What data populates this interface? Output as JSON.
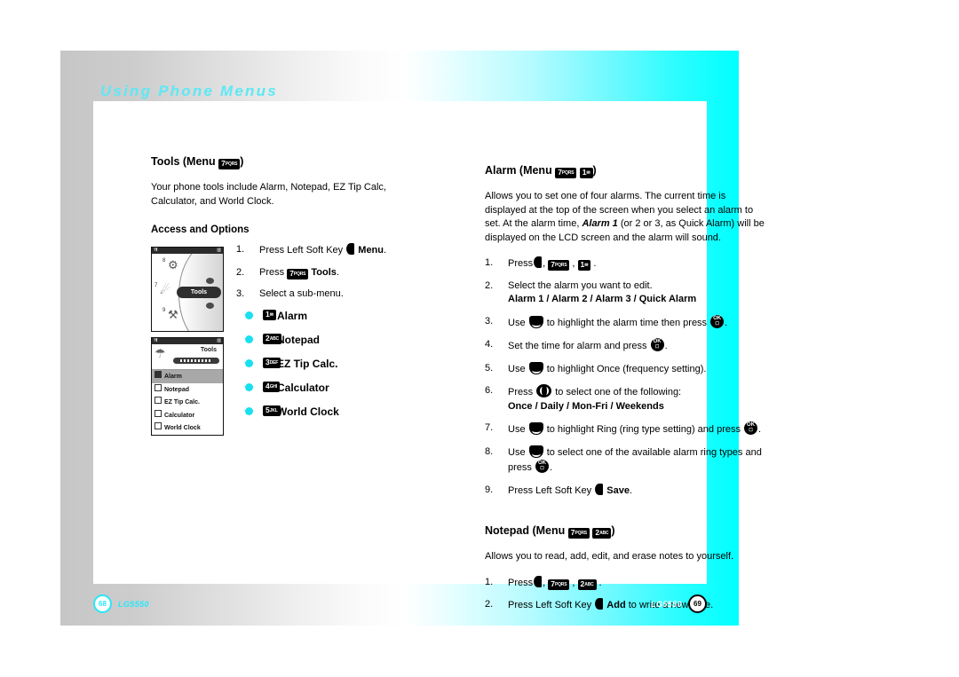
{
  "header": {
    "title": "Using Phone Menus"
  },
  "left_page": {
    "section_title": "Tools (Menu",
    "section_title_key": {
      "num": "7",
      "sub": "PQRS"
    },
    "section_title_close": ")",
    "intro": "Your phone tools include Alarm, Notepad, EZ Tip Calc, Calculator, and World Clock.",
    "subheading": "Access and Options",
    "steps": [
      {
        "num": "1.",
        "pre": "Press Left Soft Key ",
        "icon": "soft-key",
        "bold": "Menu",
        "post": "."
      },
      {
        "num": "2.",
        "pre": "Press ",
        "icon": "key",
        "key": {
          "num": "7",
          "sub": "PQRS"
        },
        "bold": "Tools",
        "post": "."
      },
      {
        "num": "3.",
        "pre": "Select a sub-menu.",
        "icon": "",
        "bold": "",
        "post": ""
      }
    ],
    "submenu": [
      {
        "key": {
          "num": "1",
          "sub": "✉"
        },
        "label": "Alarm"
      },
      {
        "key": {
          "num": "2",
          "sub": "ABC"
        },
        "label": "Notepad"
      },
      {
        "key": {
          "num": "3",
          "sub": "DEF"
        },
        "label": "EZ Tip Calc."
      },
      {
        "key": {
          "num": "4",
          "sub": "GHI"
        },
        "label": "Calculator"
      },
      {
        "key": {
          "num": "5",
          "sub": "JKL"
        },
        "label": "World Clock"
      }
    ],
    "phone1": {
      "signal": "Yil",
      "battery": "▥",
      "tab_label": "Tools",
      "icons": [
        "8",
        "7",
        "9"
      ]
    },
    "phone2": {
      "signal": "Yil",
      "battery": "▥",
      "title": "Tools",
      "items": [
        {
          "num": "1",
          "label": "Alarm",
          "selected": true
        },
        {
          "num": "2",
          "label": "Notepad",
          "selected": false
        },
        {
          "num": "3",
          "label": "EZ Tip Calc.",
          "selected": false
        },
        {
          "num": "4",
          "label": "Calculator",
          "selected": false
        },
        {
          "num": "5",
          "label": "World Clock",
          "selected": false
        }
      ]
    },
    "footer": {
      "page": "68",
      "model": "LG5550"
    }
  },
  "right_page": {
    "alarm": {
      "title_pre": "Alarm (Menu",
      "title_key1": {
        "num": "7",
        "sub": "PQRS"
      },
      "title_key2": {
        "num": "1",
        "sub": "✉"
      },
      "title_close": ")",
      "intro_1": "Allows you to set one of four alarms. The current time is displayed at the top of the screen when you select an alarm to set. At the alarm time, ",
      "intro_em": "Alarm 1",
      "intro_2": " (or 2 or 3, as Quick Alarm) will be displayed on the LCD screen and the alarm will sound.",
      "steps": [
        {
          "num": "1.",
          "text": "Press"
        },
        {
          "num": "2.",
          "text": "Select the alarm you want to edit.",
          "bold_line": "Alarm 1 / Alarm 2 / Alarm 3 / Quick Alarm"
        },
        {
          "num": "3.",
          "text_pre": "Use",
          "text_mid": "to highlight the alarm time then press",
          "text_post": "."
        },
        {
          "num": "4.",
          "text_pre": "Set the time for alarm and press",
          "text_post": "."
        },
        {
          "num": "5.",
          "text_pre": "Use",
          "text_mid": "to highlight Once (frequency setting)."
        },
        {
          "num": "6.",
          "text_pre": "Press",
          "text_mid": "to select one of the following:",
          "bold_line": "Once / Daily / Mon-Fri / Weekends"
        },
        {
          "num": "7.",
          "text_pre": "Use",
          "text_mid": "to highlight Ring (ring type setting) and press",
          "text_post": "."
        },
        {
          "num": "8.",
          "text_pre": "Use",
          "text_mid": "to select one of the available alarm ring types and press",
          "text_post": "."
        },
        {
          "num": "9.",
          "text_pre": "Press Left Soft Key",
          "bold": "Save",
          "text_post": "."
        }
      ]
    },
    "notepad": {
      "title_pre": "Notepad (Menu",
      "title_key1": {
        "num": "7",
        "sub": "PQRS"
      },
      "title_key2": {
        "num": "2",
        "sub": "ABC"
      },
      "title_close": ")",
      "intro": "Allows you to read, add, edit, and erase notes to yourself.",
      "steps": [
        {
          "num": "1.",
          "text": "Press"
        },
        {
          "num": "2.",
          "text_pre": "Press Left Soft Key",
          "bold": "Add",
          "text_post": "to write a new note."
        }
      ]
    },
    "footer": {
      "page": "69",
      "model": "LG5550"
    }
  },
  "colors": {
    "cyan": "#00ffff",
    "headline": "#5ee8f5",
    "bullet": "#18e0f0"
  }
}
